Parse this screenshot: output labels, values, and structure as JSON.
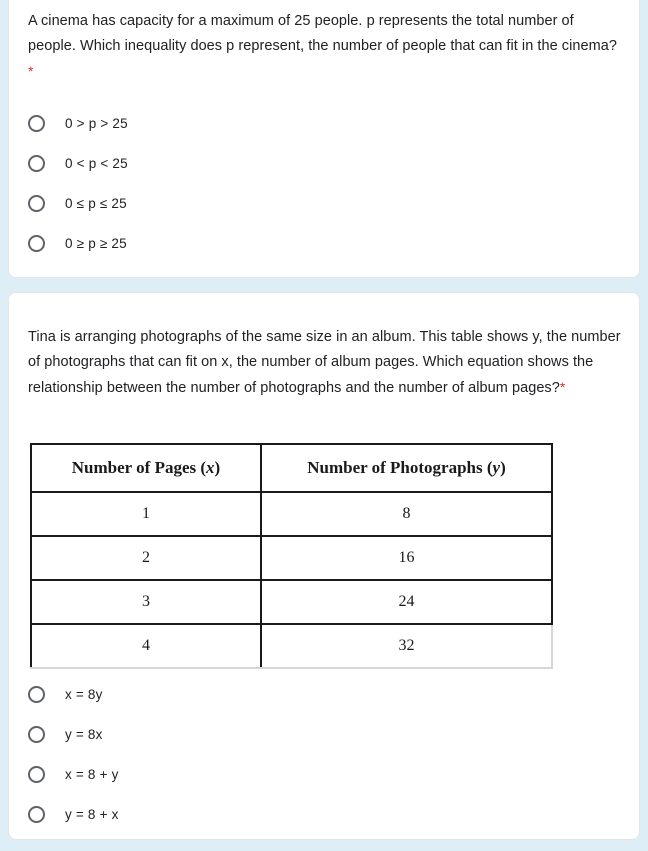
{
  "form": {
    "background_color": "#ddeef6",
    "card_color": "#ffffff",
    "required_marker": "*",
    "required_marker_color": "#d93025"
  },
  "questions": [
    {
      "id": "q1",
      "text": "A cinema has capacity for a maximum of 25 people. p represents the total number of people. Which inequality does p represent, the number of people that can fit in the cinema?",
      "required": true,
      "options": [
        {
          "label": "0 > p > 25",
          "selected": false
        },
        {
          "label": "0 < p < 25",
          "selected": false
        },
        {
          "label": "0 ≤ p ≤ 25",
          "selected": false
        },
        {
          "label": "0 ≥ p ≥ 25",
          "selected": false
        }
      ]
    },
    {
      "id": "q2",
      "text": "Tina is arranging photographs of the same size in an album. This table shows y, the number of photographs that can fit on x, the number of album pages. Which equation shows the relationship between the number of photographs and the number of album pages?",
      "required": true,
      "table": {
        "headers": [
          {
            "text": "Number of Pages (",
            "variable": "x",
            "suffix": ")"
          },
          {
            "text": "Number of Photographs (",
            "variable": "y",
            "suffix": ")"
          }
        ],
        "rows": [
          [
            "1",
            "8"
          ],
          [
            "2",
            "16"
          ],
          [
            "3",
            "24"
          ],
          [
            "4",
            "32"
          ]
        ]
      },
      "options": [
        {
          "label": "x = 8y",
          "selected": false
        },
        {
          "label": "y = 8x",
          "selected": false
        },
        {
          "label": "x = 8 + y",
          "selected": false
        },
        {
          "label": "y = 8 + x",
          "selected": false
        }
      ]
    }
  ]
}
